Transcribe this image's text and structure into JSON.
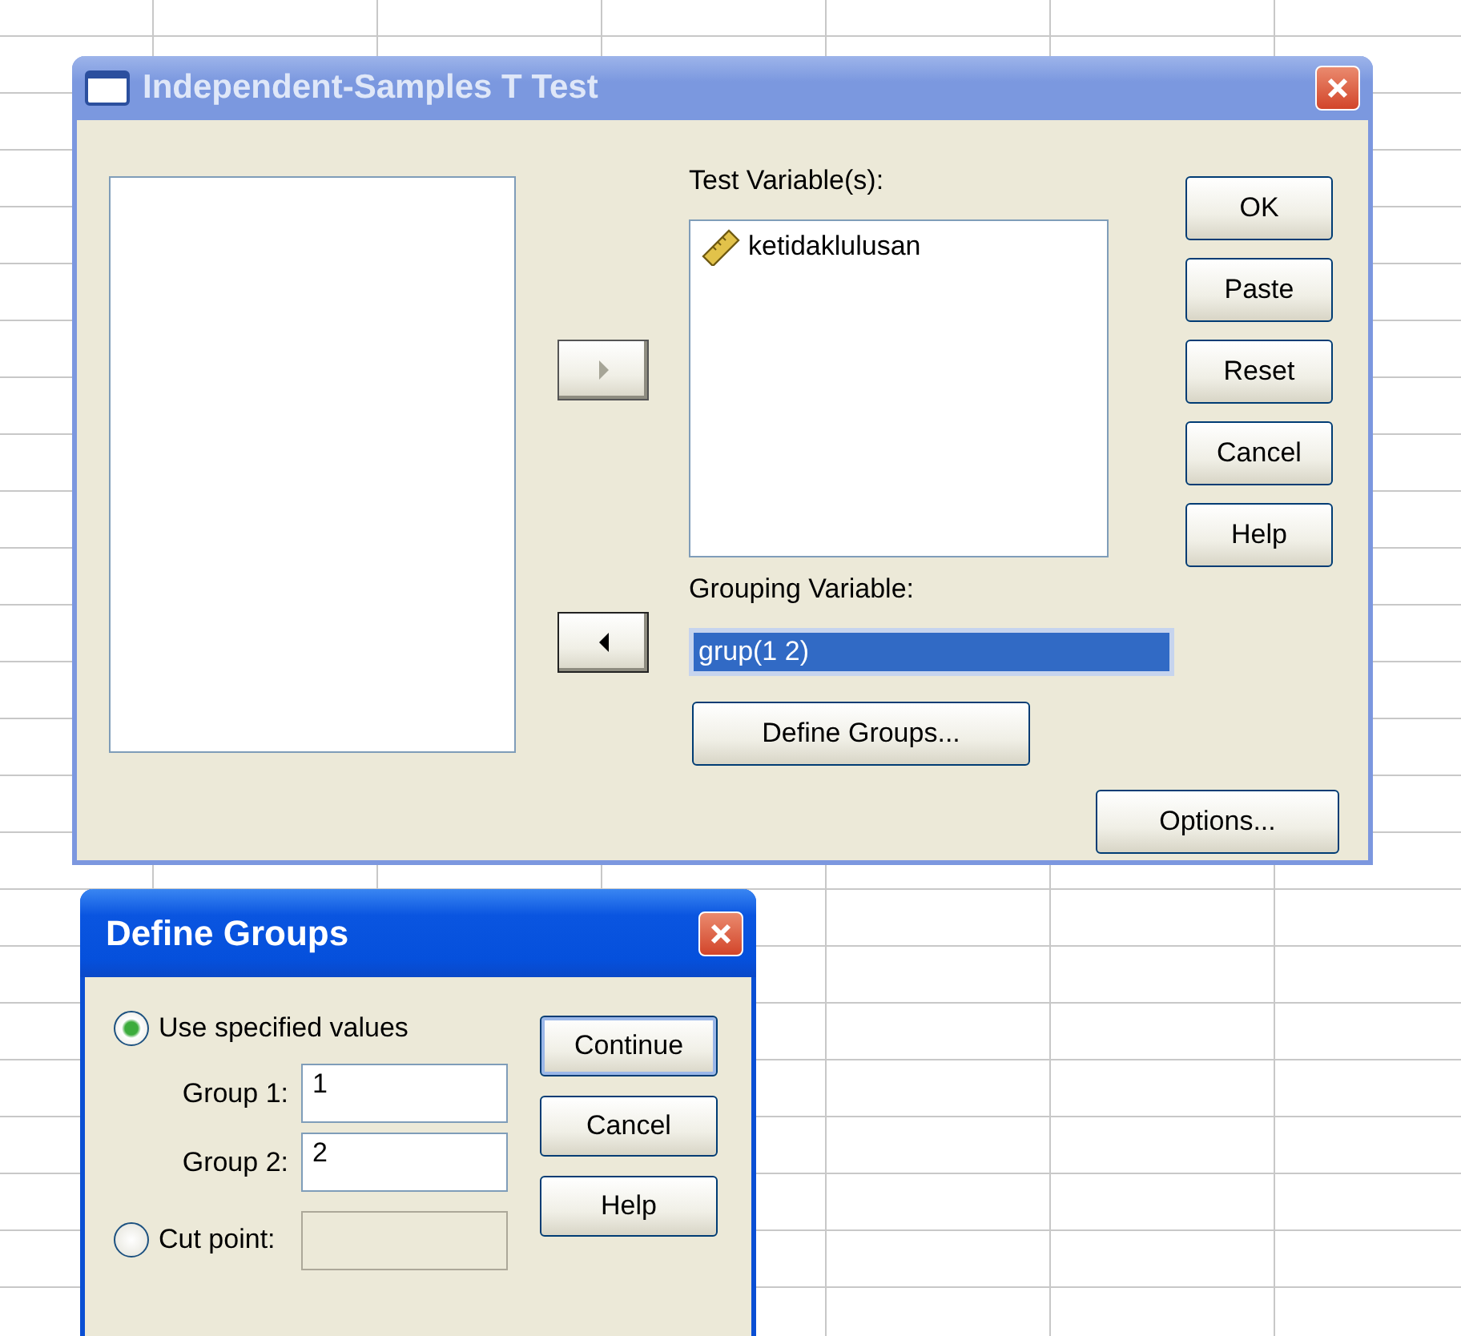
{
  "main_dialog": {
    "title": "Independent-Samples T Test",
    "arrow_buttons": [
      {
        "kind": "right",
        "disabled": true
      },
      {
        "kind": "left",
        "disabled": false
      }
    ],
    "test_variables": {
      "label": "Test Variable(s):",
      "items": [
        {
          "name": "ketidaklulusan"
        }
      ]
    },
    "grouping_variable": {
      "label": "Grouping Variable:",
      "value": "grup(1 2)",
      "selected": true
    },
    "define_groups_button": "Define Groups...",
    "buttons": [
      "OK",
      "Paste",
      "Reset",
      "Cancel",
      "Help"
    ],
    "options_button": "Options..."
  },
  "define_groups": {
    "title": "Define Groups",
    "use_specified": {
      "label": "Use specified values",
      "selected": true
    },
    "groups": [
      {
        "label": "Group 1:",
        "value": "1"
      },
      {
        "label": "Group 2:",
        "value": "2"
      }
    ],
    "cut_point": {
      "label": "Cut point:",
      "selected": false,
      "disabled": true
    },
    "buttons": [
      {
        "label": "Continue",
        "default": true
      },
      {
        "label": "Cancel",
        "default": false
      },
      {
        "label": "Help",
        "default": false
      }
    ]
  }
}
